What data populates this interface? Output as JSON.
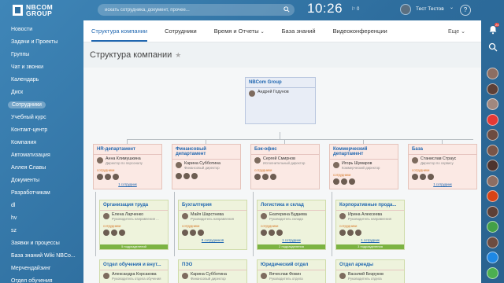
{
  "header": {
    "logo_line1": "NBCOM",
    "logo_line2": "GROUP",
    "search_placeholder": "искать сотрудника, документ, прочее...",
    "time": "10:26",
    "flag": "⚐ 0",
    "user_name": "Тест Тестов",
    "help_label": "?"
  },
  "sidebar": {
    "items": [
      {
        "label": "Новости"
      },
      {
        "label": "Задачи и Проекты"
      },
      {
        "label": "Группы"
      },
      {
        "label": "Чат и звонки"
      },
      {
        "label": "Календарь"
      },
      {
        "label": "Диск"
      },
      {
        "label": "Сотрудники",
        "active": true
      },
      {
        "label": "Учебный курс"
      },
      {
        "label": "Контакт-центр"
      },
      {
        "label": "Компания"
      },
      {
        "label": "Автоматизация"
      },
      {
        "label": "Аллея Славы"
      },
      {
        "label": "Документы"
      },
      {
        "label": "Разработчикам"
      },
      {
        "label": "dl"
      },
      {
        "label": "hv"
      },
      {
        "label": "sz"
      },
      {
        "label": "Заявки и процессы"
      },
      {
        "label": "База знаний Wiki NBCo..."
      },
      {
        "label": "Мерчендайзинг"
      },
      {
        "label": "Отдел обучения"
      }
    ]
  },
  "tabs": [
    {
      "label": "Структура компании",
      "active": true
    },
    {
      "label": "Сотрудники"
    },
    {
      "label": "Время и Отчеты",
      "chevron": "⌄"
    },
    {
      "label": "База знаний"
    },
    {
      "label": "Видеоконференции"
    }
  ],
  "tabs_more": "Еще ⌄",
  "page_title": "Структура компании",
  "org": {
    "root": {
      "title": "NBCom Group",
      "person": "Андрей Годунов"
    },
    "depts": [
      {
        "title": "HR-департамент",
        "person": "Анна Климушкина",
        "role": "Директор по персоналу",
        "employees": "сотрудники",
        "count": "1 сотрудник"
      },
      {
        "title": "Финансовый департамент",
        "person": "Карина Субботина",
        "role": "Финансовый директор",
        "employees": "",
        "count": ""
      },
      {
        "title": "Бэк-офис",
        "person": "Сергей Смирнов",
        "role": "Исполнительный директор",
        "employees": "сотрудники",
        "count": ""
      },
      {
        "title": "Коммерческий департамент",
        "person": "Игорь Шумаров",
        "role": "Коммерческий директор",
        "employees": "сотрудники",
        "count": ""
      },
      {
        "title": "База",
        "person": "Станислав Страус",
        "role": "Директор по сервису",
        "employees": "сотрудники",
        "count": "1 сотрудник"
      }
    ],
    "subs": [
      {
        "title": "Организация труда",
        "person": "Елена Ларченко",
        "role": "Руководитель направления ...",
        "employees": "сотрудники",
        "badge": "5 подразделений"
      },
      {
        "title": "Бухгалтерия",
        "person": "Майя Шарстнева",
        "role": "Руководитель направления",
        "employees": "сотрудники",
        "count": "8 сотрудников"
      },
      {
        "title": "Логистика и склад",
        "person": "Екатерина Будаева",
        "role": "Руководитель склада",
        "employees": "сотрудники",
        "count": "1 сотрудник",
        "badge": "2 подразделения"
      },
      {
        "title": "Корпоративные прода...",
        "person": "Ирина Алексеева",
        "role": "Руководитель направления",
        "employees": "сотрудники",
        "count": "1 сотрудник",
        "badge": "3 подразделения"
      },
      {
        "title": "Отдел обучения и внут...",
        "person": "Александра Корсакова",
        "role": "Руководитель отдела обучения"
      },
      {
        "title": "ПЭО",
        "person": "Карина Субботина",
        "role": "Финансовый директор"
      },
      {
        "title": "Юридический отдел",
        "person": "Вячеслав Фокин",
        "role": "Руководитель отдела"
      },
      {
        "title": "Отдел аренды",
        "person": "Василий Безруков",
        "role": "Руководитель отдела"
      }
    ]
  },
  "rail": {
    "notif_count": "24"
  }
}
